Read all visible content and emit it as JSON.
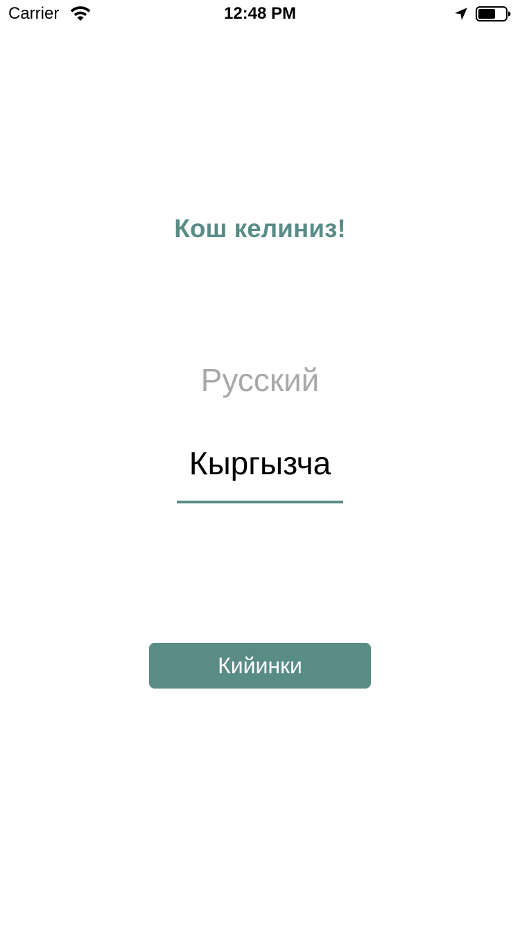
{
  "status_bar": {
    "carrier": "Carrier",
    "time": "12:48 PM",
    "icons": [
      "wifi-icon",
      "location-icon",
      "battery-icon"
    ]
  },
  "welcome": {
    "title": "Кош келиниз!"
  },
  "language_picker": {
    "options": [
      {
        "label": "Русский",
        "selected": false
      },
      {
        "label": "Кыргызча",
        "selected": true
      }
    ]
  },
  "actions": {
    "next_label": "Кийинки"
  },
  "colors": {
    "accent": "#5a8c86",
    "inactive_text": "#a9a9a9",
    "active_text": "#000000",
    "background": "#ffffff"
  }
}
